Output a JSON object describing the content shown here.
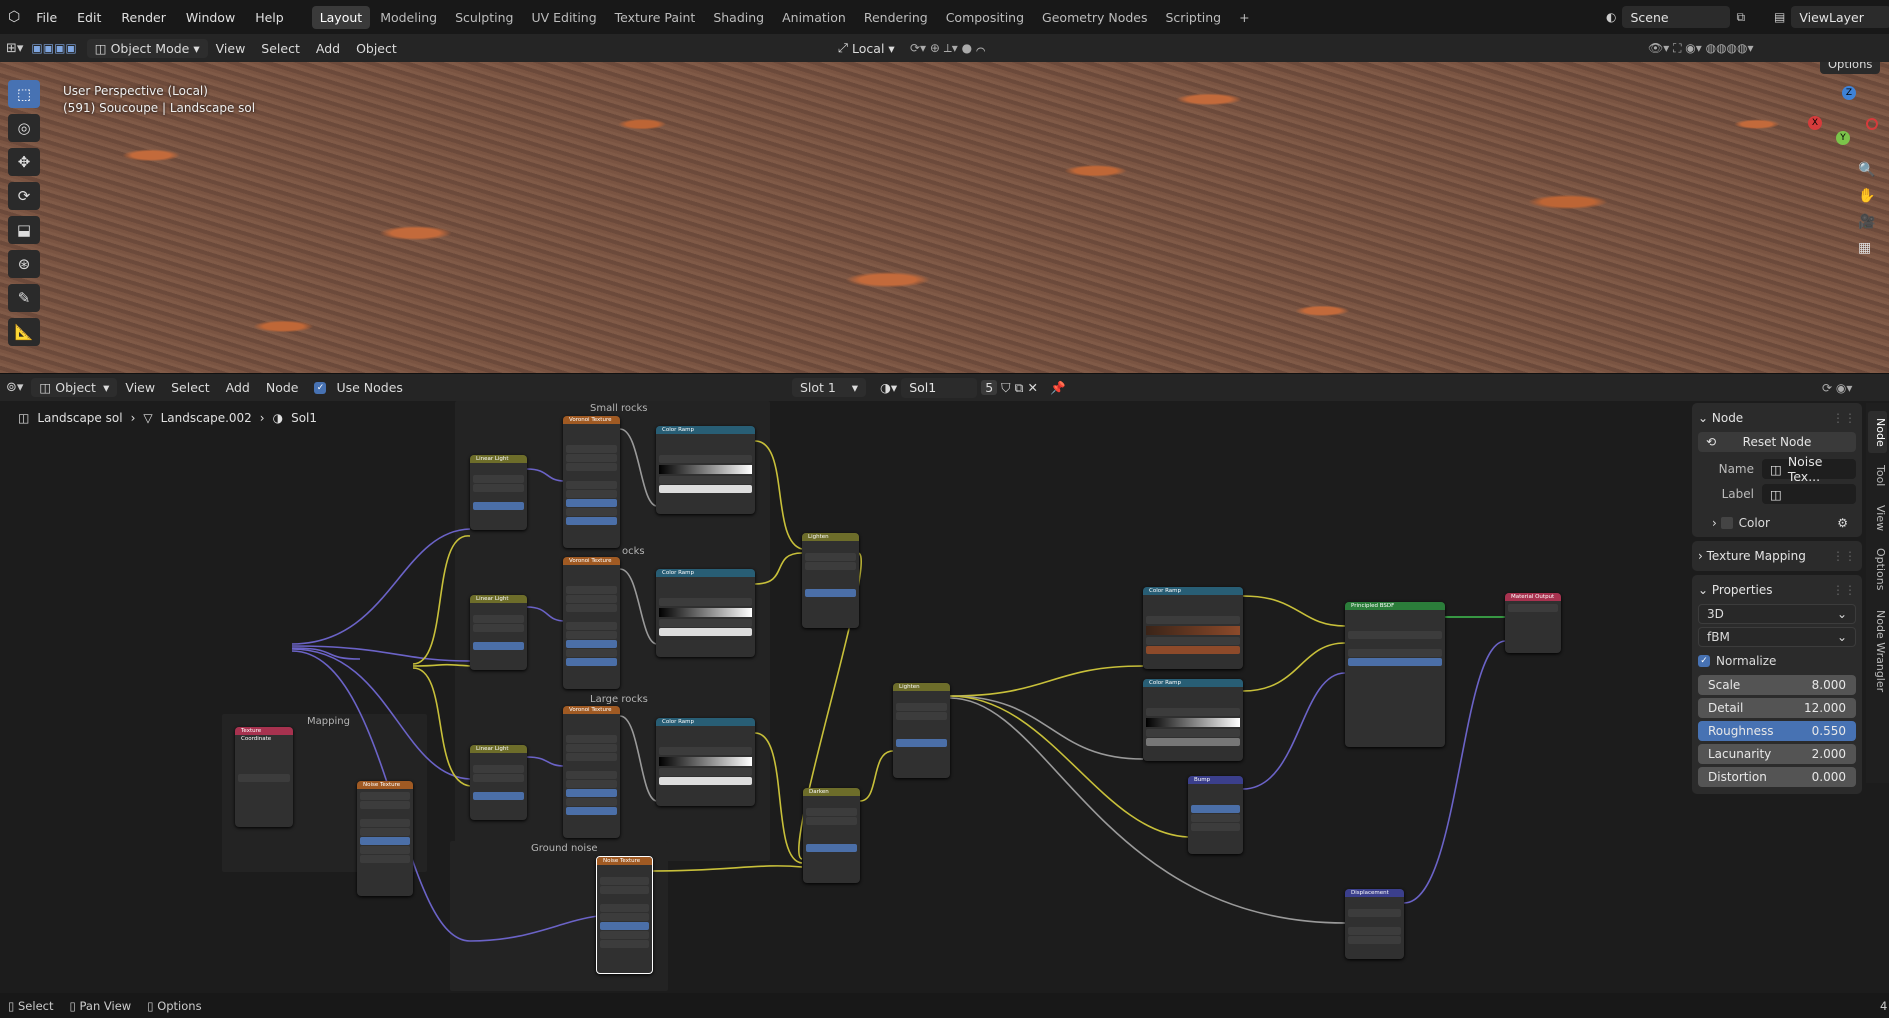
{
  "topbar": {
    "menus": [
      "File",
      "Edit",
      "Render",
      "Window",
      "Help"
    ],
    "workspaces": [
      "Layout",
      "Modeling",
      "Sculpting",
      "UV Editing",
      "Texture Paint",
      "Shading",
      "Animation",
      "Rendering",
      "Compositing",
      "Geometry Nodes",
      "Scripting"
    ],
    "active_workspace": "Layout",
    "add_tab": "+",
    "scene": "Scene",
    "view_layer": "ViewLayer"
  },
  "viewport_header": {
    "mode": "Object Mode",
    "menus": [
      "View",
      "Select",
      "Add",
      "Object"
    ],
    "transform_orientation": "Local",
    "options": "Options"
  },
  "viewport": {
    "perspective": "User Perspective (Local)",
    "object_info": "(591) Soucoupe | Landscape sol",
    "gizmo_axes": [
      "X",
      "Y",
      "Z"
    ]
  },
  "node_header": {
    "editor_type": "Object",
    "menus": [
      "View",
      "Select",
      "Add",
      "Node"
    ],
    "use_nodes": "Use Nodes",
    "slot": "Slot 1",
    "material": "Sol1",
    "users": "5"
  },
  "breadcrumb": [
    "Landscape sol",
    "Landscape.002",
    "Sol1"
  ],
  "frames": {
    "small_rocks": "Small rocks",
    "medium_rocks": "ocks",
    "large_rocks": "Large rocks",
    "ground_noise": "Ground noise",
    "mapping": "Mapping"
  },
  "nodes": {
    "texture_coordinate": "Texture Coordinate",
    "noise_texture": "Noise Texture",
    "voronoi_texture": "Voronoi Texture",
    "color_ramp": "Color Ramp",
    "linear_light": "Linear Light",
    "lighten": "Lighten",
    "darken": "Darken",
    "bump": "Bump",
    "principled_bsdf": "Principled BSDF",
    "material_output": "Material Output",
    "displacement": "Displacement"
  },
  "side_panel": {
    "node_section": "Node",
    "reset_node": "Reset Node",
    "name_label": "Name",
    "name_value": "Noise Tex...",
    "label_label": "Label",
    "label_value": "",
    "color_label": "Color",
    "texture_mapping": "Texture Mapping",
    "properties": "Properties",
    "dimensions": "3D",
    "type": "fBM",
    "normalize_label": "Normalize",
    "normalize": true,
    "fields": [
      {
        "label": "Scale",
        "value": "8.000"
      },
      {
        "label": "Detail",
        "value": "12.000"
      },
      {
        "label": "Roughness",
        "value": "0.550"
      },
      {
        "label": "Lacunarity",
        "value": "2.000"
      },
      {
        "label": "Distortion",
        "value": "0.000"
      }
    ]
  },
  "side_tabs": [
    "Node",
    "Tool",
    "View",
    "Options",
    "Node Wrangler"
  ],
  "statusbar": {
    "select": "Select",
    "pan_view": "Pan View",
    "options": "Options",
    "version": "4"
  },
  "colors": {
    "accent": "#4772b3",
    "wire_yellow": "#c8c03a",
    "wire_purple": "#6b63c7",
    "wire_grey": "#9a9a9a",
    "wire_green": "#40c050"
  }
}
